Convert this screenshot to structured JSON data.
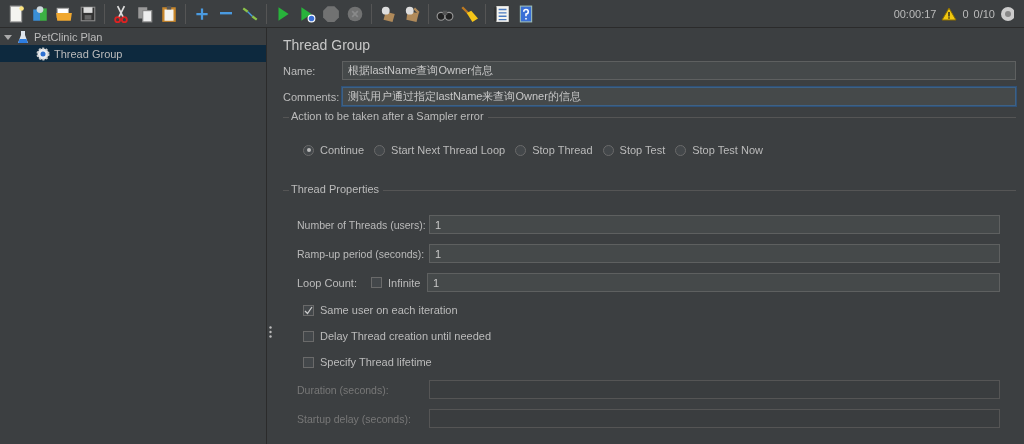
{
  "toolbar": {
    "groups": [
      [
        {
          "kind": "new",
          "disabled": false
        },
        {
          "kind": "templates",
          "disabled": false
        },
        {
          "kind": "open",
          "disabled": false
        },
        {
          "kind": "save",
          "disabled": false
        }
      ],
      [
        {
          "kind": "cut",
          "disabled": false
        },
        {
          "kind": "copy",
          "disabled": false
        },
        {
          "kind": "paste",
          "disabled": false
        }
      ],
      [
        {
          "kind": "expand",
          "disabled": false
        },
        {
          "kind": "collapse",
          "disabled": false
        },
        {
          "kind": "toggle",
          "disabled": false
        }
      ],
      [
        {
          "kind": "start",
          "disabled": false
        },
        {
          "kind": "start-no-pause",
          "disabled": false
        },
        {
          "kind": "stop",
          "disabled": true
        },
        {
          "kind": "shutdown",
          "disabled": true
        }
      ],
      [
        {
          "kind": "clear",
          "disabled": false
        },
        {
          "kind": "clear-all",
          "disabled": false
        }
      ],
      [
        {
          "kind": "search",
          "disabled": false
        },
        {
          "kind": "reset-search",
          "disabled": false
        }
      ],
      [
        {
          "kind": "function-helper",
          "disabled": false
        },
        {
          "kind": "help",
          "disabled": false
        }
      ]
    ],
    "status": {
      "elapsed": "00:00:17",
      "warnings": "0",
      "threads": "0/10"
    }
  },
  "tree": [
    {
      "label": "PetClinic Plan",
      "kind": "test-plan",
      "expanded": true,
      "selected": false,
      "children": [
        {
          "label": "Thread Group",
          "kind": "thread-group",
          "selected": true
        }
      ]
    }
  ],
  "panel": {
    "title": "Thread Group",
    "name": {
      "label": "Name:",
      "value": "根据lastName查询Owner信息",
      "focused": false
    },
    "comments": {
      "label": "Comments:",
      "value": "测试用户通过指定lastName来查询Owner的信息",
      "focused": true
    },
    "sampler_error": {
      "legend": "Action to be taken after a Sampler error",
      "options": [
        {
          "label": "Continue",
          "selected": true
        },
        {
          "label": "Start Next Thread Loop",
          "selected": false
        },
        {
          "label": "Stop Thread",
          "selected": false
        },
        {
          "label": "Stop Test",
          "selected": false
        },
        {
          "label": "Stop Test Now",
          "selected": false
        }
      ]
    },
    "thread_properties": {
      "legend": "Thread Properties",
      "threads": {
        "label": "Number of Threads (users):",
        "value": "1"
      },
      "ramp_up": {
        "label": "Ramp-up period (seconds):",
        "value": "1"
      },
      "loop_count": {
        "label": "Loop Count:",
        "infinite_label": "Infinite",
        "infinite": false,
        "value": "1"
      },
      "options": [
        {
          "label": "Same user on each iteration",
          "checked": true
        },
        {
          "label": "Delay Thread creation until needed",
          "checked": false
        },
        {
          "label": "Specify Thread lifetime",
          "checked": false
        }
      ],
      "duration": {
        "label": "Duration (seconds):",
        "disabled": true
      },
      "startup_delay": {
        "label": "Startup delay (seconds):",
        "disabled": true
      }
    }
  }
}
